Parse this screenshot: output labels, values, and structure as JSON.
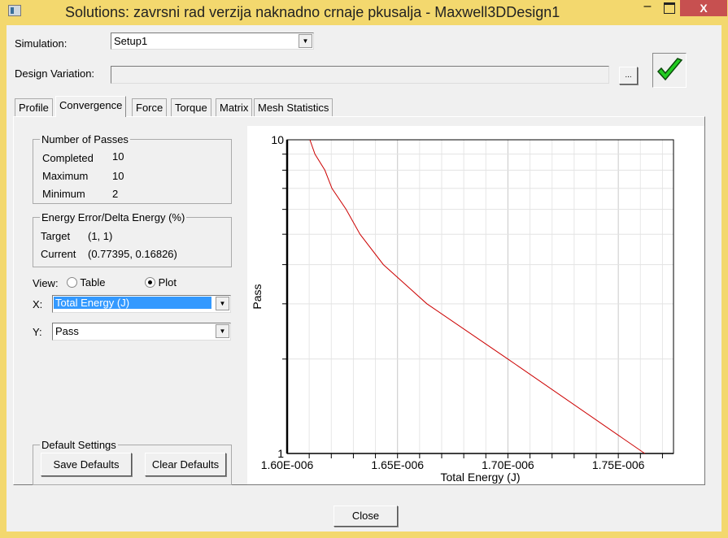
{
  "window": {
    "title": "Solutions: zavrsni rad verzija naknadno crnaje pkusalja - Maxwell3DDesign1",
    "minimize": "–",
    "close": "X"
  },
  "simulation": {
    "label": "Simulation:",
    "value": "Setup1"
  },
  "design_variation": {
    "label": "Design Variation:",
    "value": "",
    "browse": "..."
  },
  "status_icon": "green-checkmark",
  "tabs": [
    {
      "label": "Profile"
    },
    {
      "label": "Convergence",
      "active": true
    },
    {
      "label": "Force"
    },
    {
      "label": "Torque"
    },
    {
      "label": "Matrix"
    },
    {
      "label": "Mesh Statistics"
    }
  ],
  "passes": {
    "title": "Number of Passes",
    "completed_label": "Completed",
    "completed": "10",
    "maximum_label": "Maximum",
    "maximum": "10",
    "minimum_label": "Minimum",
    "minimum": "2"
  },
  "energy": {
    "title": "Energy Error/Delta Energy (%)",
    "target_label": "Target",
    "target": "(1, 1)",
    "current_label": "Current",
    "current": "(0.77395, 0.16826)"
  },
  "view": {
    "label": "View:",
    "table": "Table",
    "plot": "Plot",
    "selected": "Plot"
  },
  "x_select": {
    "label": "X:",
    "value": "Total Energy (J)"
  },
  "y_select": {
    "label": "Y:",
    "value": "Pass"
  },
  "defaults": {
    "title": "Default Settings",
    "save": "Save Defaults",
    "clear": "Clear Defaults"
  },
  "close_button": "Close",
  "colors": {
    "line": "#cc0000",
    "window_frame": "#f3d86e",
    "close_button": "#c75050",
    "selection": "#3399ff"
  },
  "chart_data": {
    "type": "line",
    "xlabel": "Total Energy (J)",
    "ylabel": "Pass",
    "xlim": [
      1.6e-06,
      1.775e-06
    ],
    "ylim": [
      1,
      10
    ],
    "yscale": "log",
    "grid": true,
    "x_ticks": [
      "1.60E-006",
      "1.65E-006",
      "1.70E-006",
      "1.75E-006"
    ],
    "x_tick_values": [
      1.6e-06,
      1.65e-06,
      1.7e-06,
      1.75e-06
    ],
    "y_ticks": [
      "1",
      "10"
    ],
    "x": [
      1.6103e-06,
      1.6126e-06,
      1.6171e-06,
      1.6203e-06,
      1.6267e-06,
      1.633e-06,
      1.6436e-06,
      1.6633e-06,
      1.7e-06,
      1.762e-06
    ],
    "y": [
      10,
      9,
      8,
      7,
      6,
      5,
      4,
      3,
      2,
      1
    ]
  }
}
